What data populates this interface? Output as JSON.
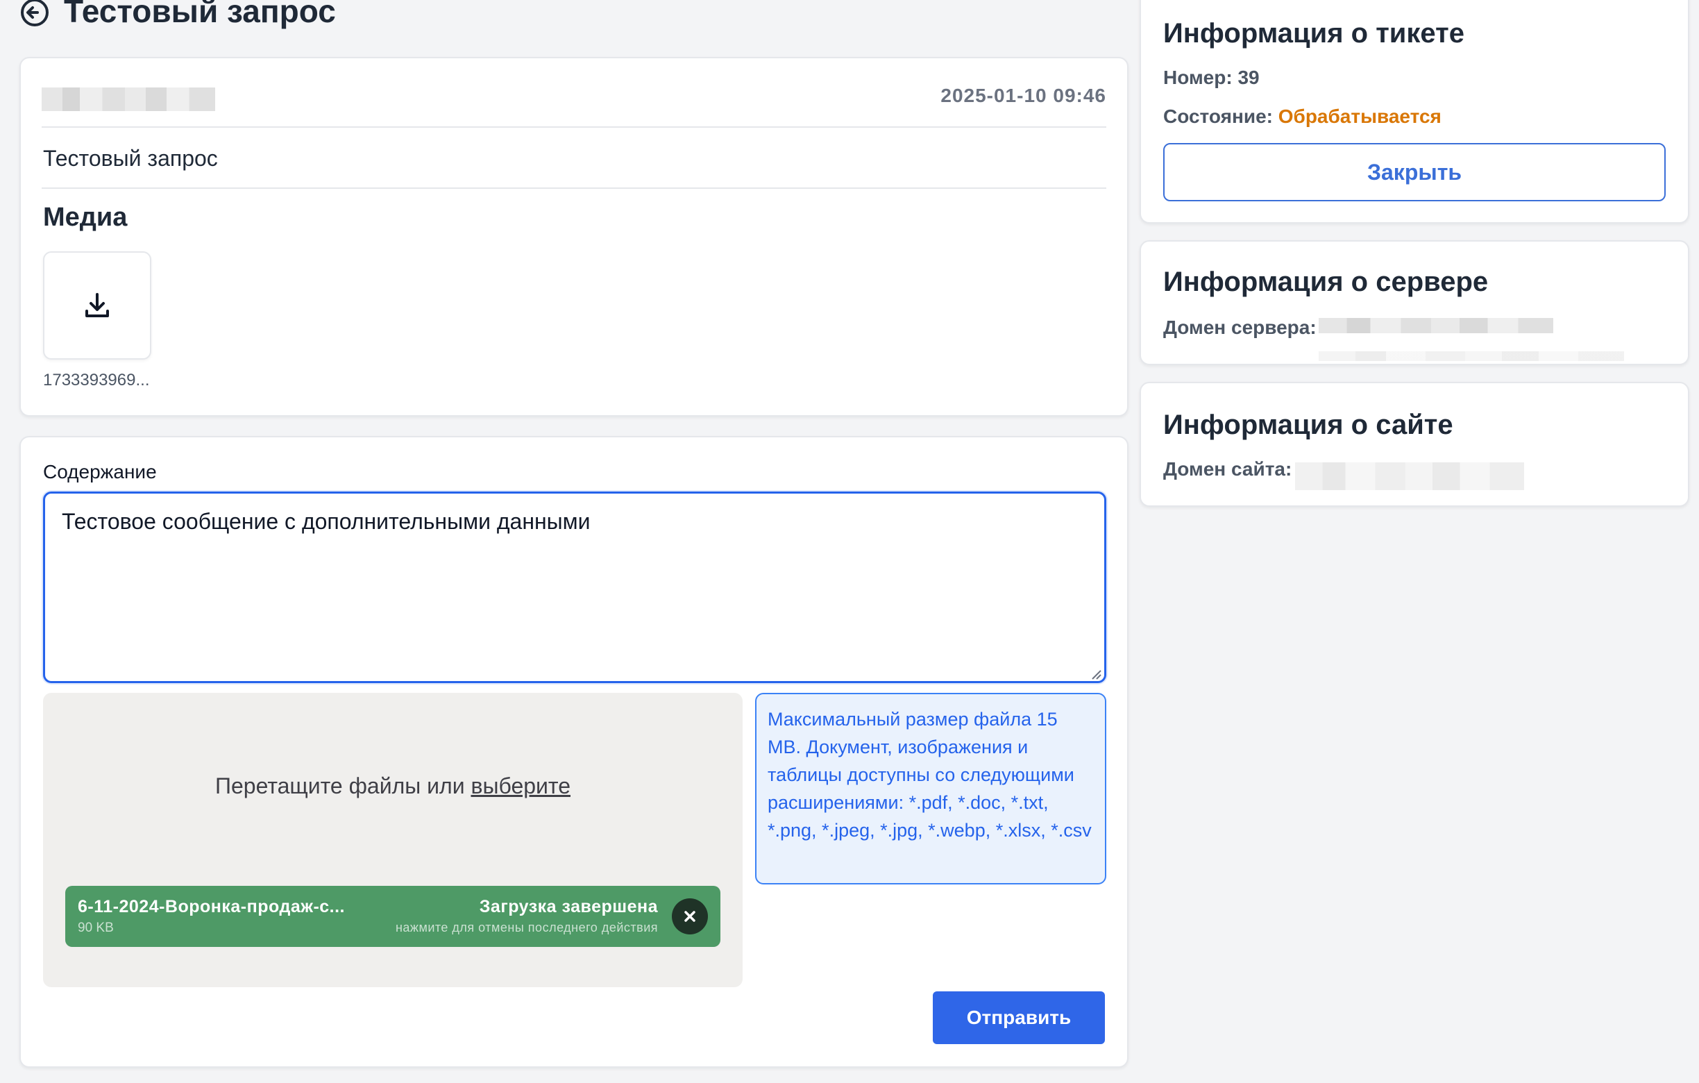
{
  "page": {
    "title": "Тестовый запрос"
  },
  "message": {
    "timestamp": "2025-01-10 09:46",
    "subject": "Тестовый запрос",
    "media_heading": "Медиа",
    "attachment_name": "1733393969..."
  },
  "reply": {
    "content_label": "Содержание",
    "content_value": "Тестовое сообщение с дополнительными данными",
    "dropzone_text": "Перетащите файлы или ",
    "dropzone_link": "выберите",
    "upload": {
      "file_name": "6-11-2024-Воронка-продаж-с...",
      "file_size": "90 KB",
      "status": "Загрузка завершена",
      "hint": "нажмите для отмены последнего действия"
    },
    "info_text": "Максимальный размер файла 15 MB. Документ, изображения и таблицы доступны со следующими расширениями: *.pdf, *.doc, *.txt, *.png, *.jpeg, *.jpg, *.webp, *.xlsx, *.csv",
    "submit_label": "Отправить"
  },
  "ticket_info": {
    "heading": "Информация о тикете",
    "number_label": "Номер:",
    "number_value": "39",
    "state_label": "Состояние:",
    "state_value": "Обрабатывается",
    "close_label": "Закрыть"
  },
  "server_info": {
    "heading": "Информация о сервере",
    "domain_label": "Домен сервера:"
  },
  "site_info": {
    "heading": "Информация о сайте",
    "domain_label": "Домен сайта:"
  },
  "colors": {
    "accent": "#2563eb",
    "state": "#d97706",
    "upload_green": "#4e9a66",
    "info_bg": "#eaf2fd"
  },
  "icons": [
    "back-arrow-icon",
    "download-icon",
    "close-icon"
  ]
}
